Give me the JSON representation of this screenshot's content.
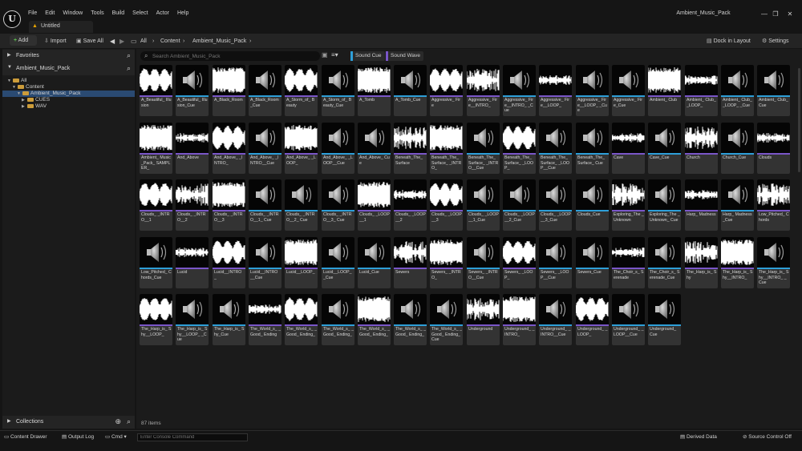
{
  "app": {
    "logo_glyph": "U",
    "menu": [
      "File",
      "Edit",
      "Window",
      "Tools",
      "Build",
      "Select",
      "Actor",
      "Help"
    ],
    "project_name": "Ambient_Music_Pack",
    "tab_label": "Untitled",
    "window_controls": [
      "—",
      "❐",
      "✕"
    ]
  },
  "toolbar": {
    "add_label": "Add",
    "import_label": "Import",
    "save_all_label": "Save All",
    "breadcrumb": [
      "All",
      "Content",
      "Ambient_Music_Pack"
    ],
    "dock_label": "Dock in Layout",
    "settings_label": "Settings"
  },
  "sidebar": {
    "favorites_label": "Favorites",
    "project_header": "Ambient_Music_Pack",
    "tree": [
      {
        "label": "All",
        "depth": 0,
        "expanded": true,
        "selected": false
      },
      {
        "label": "Content",
        "depth": 1,
        "expanded": true,
        "selected": false
      },
      {
        "label": "Ambient_Music_Pack",
        "depth": 2,
        "expanded": true,
        "selected": true
      },
      {
        "label": "CUES",
        "depth": 3,
        "expanded": false,
        "selected": false
      },
      {
        "label": "WAV",
        "depth": 3,
        "expanded": false,
        "selected": false
      }
    ],
    "collections_label": "Collections"
  },
  "search": {
    "placeholder": "Search Ambient_Music_Pack"
  },
  "filters": [
    {
      "label": "Sound Cue",
      "color": "#2e9fd8"
    },
    {
      "label": "Sound Wave",
      "color": "#7a56c8"
    }
  ],
  "assets": [
    {
      "label": "A_Beautiful_ Illusion",
      "kind": "wave"
    },
    {
      "label": "A_Beautiful_ Illusion_Cue",
      "kind": "cue"
    },
    {
      "label": "A_Black_Room",
      "kind": "wave"
    },
    {
      "label": "A_Black_Room _Cue",
      "kind": "cue"
    },
    {
      "label": "A_Storm_of_ Beauty",
      "kind": "wave"
    },
    {
      "label": "A_Storm_of_ Beauty_Cue",
      "kind": "cue"
    },
    {
      "label": "A_Tomb",
      "kind": "wave"
    },
    {
      "label": "A_Tomb_Cue",
      "kind": "cue"
    },
    {
      "label": "Aggressive_ Fire",
      "kind": "wave"
    },
    {
      "label": "Aggressive_ Fire__INTRO_",
      "kind": "wave"
    },
    {
      "label": "Aggressive_ Fire__INTRO_ _Cue",
      "kind": "cue"
    },
    {
      "label": "Aggressive_ Fire__LOOP_",
      "kind": "wave"
    },
    {
      "label": "Aggressive_ Fire__LOOP_ _Cue",
      "kind": "cue"
    },
    {
      "label": "Aggressive_ Fire_Cue",
      "kind": "cue"
    },
    {
      "label": "Ambient_ Club",
      "kind": "wave"
    },
    {
      "label": "Ambient_ Club__LOOP_",
      "kind": "wave"
    },
    {
      "label": "Ambient_ Club__LOOP_ _Cue",
      "kind": "cue"
    },
    {
      "label": "Ambient_ Club_Cue",
      "kind": "cue"
    },
    {
      "label": "Ambient_ Music_Pack_ SAMPLER_",
      "kind": "wave"
    },
    {
      "label": "And_Above",
      "kind": "wave"
    },
    {
      "label": "And_Above_ _INTRO_",
      "kind": "wave"
    },
    {
      "label": "And_Above_ _INTRO__Cue",
      "kind": "cue"
    },
    {
      "label": "And_Above_ _LOOP_",
      "kind": "wave"
    },
    {
      "label": "And_Above_ _LOOP__Cue",
      "kind": "cue"
    },
    {
      "label": "And_Above_ Cue",
      "kind": "cue"
    },
    {
      "label": "Beneath_The_ Surface",
      "kind": "wave"
    },
    {
      "label": "Beneath_The_ Surface_ _INTRO_",
      "kind": "wave"
    },
    {
      "label": "Beneath_The_ Surface_ _INTRO__Cue",
      "kind": "cue"
    },
    {
      "label": "Beneath_The_ Surface_ _LOOP_",
      "kind": "wave"
    },
    {
      "label": "Beneath_The_ Surface_ _LOOP__Cue",
      "kind": "cue"
    },
    {
      "label": "Beneath_The_ Surface_ Cue",
      "kind": "cue"
    },
    {
      "label": "Cave",
      "kind": "wave"
    },
    {
      "label": "Cave_Cue",
      "kind": "cue"
    },
    {
      "label": "Church",
      "kind": "wave"
    },
    {
      "label": "Church_Cue",
      "kind": "cue"
    },
    {
      "label": "Clouds",
      "kind": "wave"
    },
    {
      "label": "Clouds_ _INTRO__1",
      "kind": "wave"
    },
    {
      "label": "Clouds_ _INTRO__2",
      "kind": "wave"
    },
    {
      "label": "Clouds_ _INTRO__3",
      "kind": "wave"
    },
    {
      "label": "Clouds_ _INTRO__1_ Cue",
      "kind": "cue"
    },
    {
      "label": "Clouds_ _INTRO__2_ Cue",
      "kind": "cue"
    },
    {
      "label": "Clouds_ _INTRO__3_ Cue",
      "kind": "cue"
    },
    {
      "label": "Clouds_ _LOOP__1",
      "kind": "wave"
    },
    {
      "label": "Clouds_ _LOOP__2",
      "kind": "wave"
    },
    {
      "label": "Clouds_ _LOOP__3",
      "kind": "wave"
    },
    {
      "label": "Clouds_ _LOOP__1_Cue",
      "kind": "cue"
    },
    {
      "label": "Clouds_ _LOOP__2_Cue",
      "kind": "cue"
    },
    {
      "label": "Clouds_ _LOOP__3_Cue",
      "kind": "cue"
    },
    {
      "label": "Clouds_Cue",
      "kind": "cue"
    },
    {
      "label": "Exploring_The _Unknown",
      "kind": "wave"
    },
    {
      "label": "Exploring_The _Unknown_ Cue",
      "kind": "cue"
    },
    {
      "label": "Harp_ Madness",
      "kind": "wave"
    },
    {
      "label": "Harp_ Madness_Cue",
      "kind": "cue"
    },
    {
      "label": "Low_Pitched_ Chords",
      "kind": "wave"
    },
    {
      "label": "Low_Pitched_ Chords_Cue",
      "kind": "cue"
    },
    {
      "label": "Lucid",
      "kind": "wave"
    },
    {
      "label": "Lucid__INTRO _",
      "kind": "wave"
    },
    {
      "label": "Lucid__INTRO __Cue",
      "kind": "cue"
    },
    {
      "label": "Lucid__LOOP_",
      "kind": "wave"
    },
    {
      "label": "Lucid__LOOP_ _Cue",
      "kind": "cue"
    },
    {
      "label": "Lucid_Cue",
      "kind": "cue"
    },
    {
      "label": "Sewers",
      "kind": "wave"
    },
    {
      "label": "Sewers_ _INTRO_",
      "kind": "wave"
    },
    {
      "label": "Sewers_ _INTRO__Cue",
      "kind": "cue"
    },
    {
      "label": "Sewers_ _LOOP_",
      "kind": "wave"
    },
    {
      "label": "Sewers_ _LOOP__Cue",
      "kind": "cue"
    },
    {
      "label": "Sewers_Cue",
      "kind": "cue"
    },
    {
      "label": "The_Choir_s_ Serenade",
      "kind": "wave"
    },
    {
      "label": "The_Choir_s_ Serenade_Cue",
      "kind": "cue"
    },
    {
      "label": "The_Harp_is_ Shy",
      "kind": "wave"
    },
    {
      "label": "The_Harp_is_ Shy__INTRO_",
      "kind": "wave"
    },
    {
      "label": "The_Harp_is_ Shy__INTRO_ _Cue",
      "kind": "cue"
    },
    {
      "label": "The_Harp_is_ Shy__LOOP_",
      "kind": "wave"
    },
    {
      "label": "The_Harp_is_ Shy__LOOP_ _Cue",
      "kind": "cue"
    },
    {
      "label": "The_Harp_is_ Shy_Cue",
      "kind": "cue"
    },
    {
      "label": "The_World_s_ _Good_ Ending",
      "kind": "wave"
    },
    {
      "label": "The_World_s_ _Good_ Ending_",
      "kind": "wave"
    },
    {
      "label": "The_World_s_ _Good_ Ending_",
      "kind": "cue"
    },
    {
      "label": "The_World_s_ _Good_ Ending_",
      "kind": "wave"
    },
    {
      "label": "The_World_s_ _Good_ Ending_",
      "kind": "cue"
    },
    {
      "label": "The_World_s_ _Good_ Ending_Cue",
      "kind": "cue"
    },
    {
      "label": "Underground",
      "kind": "wave"
    },
    {
      "label": "Underground_ _INTRO_",
      "kind": "wave"
    },
    {
      "label": "Underground_ _INTRO__Cue",
      "kind": "cue"
    },
    {
      "label": "Underground_ _LOOP_",
      "kind": "wave"
    },
    {
      "label": "Underground_ _LOOP__Cue",
      "kind": "cue"
    },
    {
      "label": "Underground_ Cue",
      "kind": "cue"
    }
  ],
  "item_count": "87 items",
  "statusbar": {
    "content_drawer": "Content Drawer",
    "output_log": "Output Log",
    "cmd": "Cmd",
    "console_placeholder": "Enter Console Command",
    "derived_data": "Derived Data",
    "source_control": "Source Control Off"
  }
}
